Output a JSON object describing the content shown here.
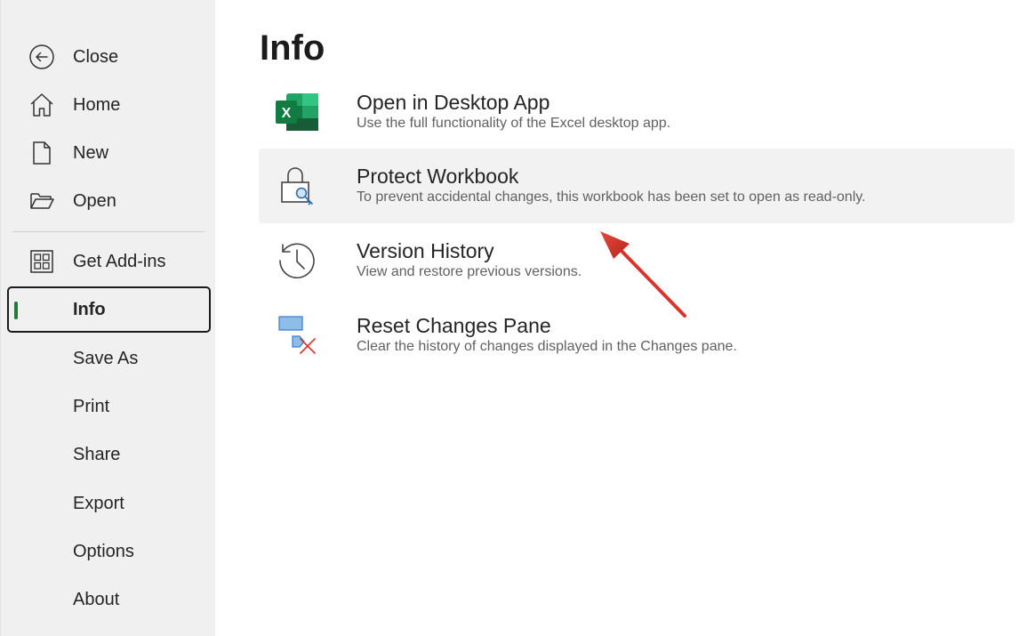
{
  "sidebar": {
    "items": [
      {
        "label": "Close",
        "icon": "back-arrow-icon"
      },
      {
        "label": "Home",
        "icon": "home-icon"
      },
      {
        "label": "New",
        "icon": "new-document-icon"
      },
      {
        "label": "Open",
        "icon": "open-folder-icon"
      },
      {
        "label": "Get Add-ins",
        "icon": "add-ins-grid-icon"
      },
      {
        "label": "Info",
        "icon": ""
      },
      {
        "label": "Save As",
        "icon": ""
      },
      {
        "label": "Print",
        "icon": ""
      },
      {
        "label": "Share",
        "icon": ""
      },
      {
        "label": "Export",
        "icon": ""
      },
      {
        "label": "Options",
        "icon": ""
      },
      {
        "label": "About",
        "icon": ""
      }
    ],
    "active": "Info"
  },
  "main": {
    "title": "Info",
    "options": [
      {
        "title": "Open in Desktop App",
        "description": "Use the full functionality of the Excel desktop app.",
        "icon": "excel-icon"
      },
      {
        "title": "Protect Workbook",
        "description": "To prevent accidental changes, this workbook has been set to open as read-only.",
        "icon": "lock-key-icon"
      },
      {
        "title": "Version History",
        "description": "View and restore previous versions.",
        "icon": "history-clock-icon"
      },
      {
        "title": "Reset Changes Pane",
        "description": "Clear the history of changes displayed in the Changes pane.",
        "icon": "reset-changes-icon"
      }
    ]
  },
  "colors": {
    "sidebar_bg": "#f0f0f0",
    "active_accent": "#1e7a3d",
    "annotation_arrow": "#d9342b",
    "excel_green": "#107c41"
  }
}
